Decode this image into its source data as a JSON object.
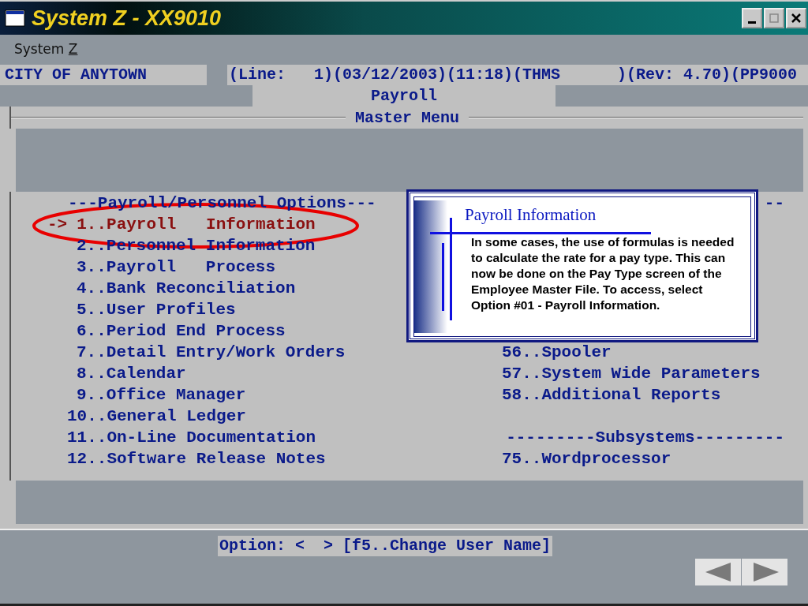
{
  "window": {
    "title": "System Z - XX9010"
  },
  "menu_bar": [
    {
      "label": "System ",
      "accelerator": "Z"
    }
  ],
  "status_line": {
    "organization": "CITY OF ANYTOWN",
    "session": "(Line:   1)(03/12/2003)(11:18)(THMS      )(Rev: 4.70)(PP9000"
  },
  "module": "Payroll",
  "frame_title": "Master Menu",
  "left_column": {
    "header": "---Payroll/Personnel Options---",
    "pointer": "->",
    "items": [
      {
        "text": "1..Payroll   Information",
        "selected": true
      },
      {
        "text": "2..Personnel Information",
        "selected": false
      },
      {
        "text": "3..Payroll   Process",
        "selected": false
      },
      {
        "text": "4..Bank Reconciliation",
        "selected": false
      },
      {
        "text": "5..User Profiles",
        "selected": false
      },
      {
        "text": "6..Period End Process",
        "selected": false
      },
      {
        "text": "7..Detail Entry/Work Orders",
        "selected": false
      },
      {
        "text": "8..Calendar",
        "selected": false
      },
      {
        "text": "9..Office Manager",
        "selected": false
      },
      {
        "text": "10..General Ledger",
        "selected": false
      },
      {
        "text": "11..On-Line Documentation",
        "selected": false
      },
      {
        "text": "12..Software Release Notes",
        "selected": false
      }
    ]
  },
  "right_column": [
    {
      "kind": "header",
      "text": "--"
    },
    {
      "kind": "blank"
    },
    {
      "kind": "blank"
    },
    {
      "kind": "blank"
    },
    {
      "kind": "blank"
    },
    {
      "kind": "blank"
    },
    {
      "kind": "blank"
    },
    {
      "kind": "item",
      "text": "56..Spooler"
    },
    {
      "kind": "item",
      "text": "57..System Wide Parameters"
    },
    {
      "kind": "item",
      "text": "58..Additional Reports"
    },
    {
      "kind": "blank"
    },
    {
      "kind": "header",
      "text": "---------Subsystems---------"
    },
    {
      "kind": "item",
      "text": "75..Wordprocessor"
    }
  ],
  "callout": {
    "title": "Payroll Information",
    "body": "In some cases, the use of formulas is needed to calculate the rate for a pay type. This can now be done on the Pay Type screen of the Employee Master File.  To access, select Option #01 - Payroll Information."
  },
  "prompt": "Option: <  > [f5..Change User Name]"
}
